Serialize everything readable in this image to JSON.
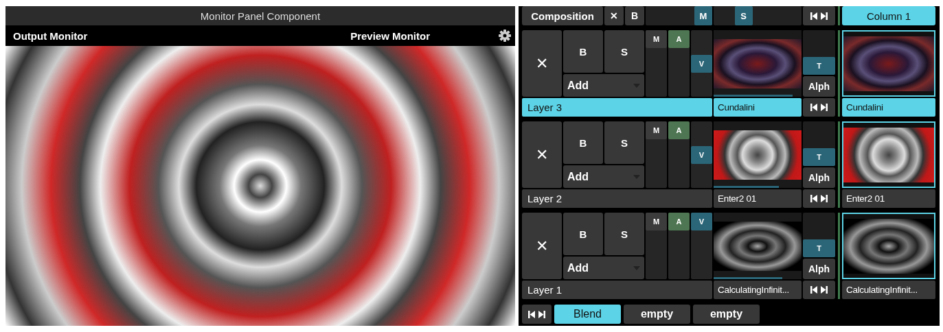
{
  "monitor": {
    "title": "Monitor Panel Component",
    "output_label": "Output Monitor",
    "preview_label": "Preview Monitor"
  },
  "composition": {
    "label": "Composition",
    "clear": "✕",
    "bypass": "B",
    "master": {
      "label": "M",
      "level": 1
    },
    "speed": {
      "label": "S",
      "level": 0.3
    }
  },
  "column": {
    "label": "Column 1",
    "selected": true
  },
  "layers": [
    {
      "name": "Layer 3",
      "selected": true,
      "clear": "✕",
      "bypass": "B",
      "solo": "S",
      "blend": "Add",
      "faders": [
        {
          "label": "M",
          "level": 1,
          "color": "#3c3c3c"
        },
        {
          "label": "A",
          "level": 1,
          "color": "#4e7652"
        },
        {
          "label": "V",
          "level": 0.5,
          "color": "#2b6678"
        }
      ],
      "transition": {
        "label": "T",
        "level": 0
      },
      "alpha": "Alph",
      "clip": {
        "name": "Cundalini",
        "selected": true,
        "level": 0.9
      },
      "column_clip": {
        "name": "Cundalini",
        "selected": true
      }
    },
    {
      "name": "Layer 2",
      "selected": false,
      "clear": "✕",
      "bypass": "B",
      "solo": "S",
      "blend": "Add",
      "faders": [
        {
          "label": "M",
          "level": 1,
          "color": "#3c3c3c"
        },
        {
          "label": "A",
          "level": 1,
          "color": "#4e7652"
        },
        {
          "label": "V",
          "level": 0.5,
          "color": "#2b6678"
        }
      ],
      "transition": {
        "label": "T",
        "level": 0
      },
      "alpha": "Alph",
      "clip": {
        "name": "Enter2 01",
        "selected": false,
        "level": 0.74
      },
      "column_clip": {
        "name": "Enter2 01",
        "selected": false
      }
    },
    {
      "name": "Layer 1",
      "selected": false,
      "clear": "✕",
      "bypass": "B",
      "solo": "S",
      "blend": "Add",
      "faders": [
        {
          "label": "M",
          "level": 1,
          "color": "#3c3c3c"
        },
        {
          "label": "A",
          "level": 1,
          "color": "#4e7652"
        },
        {
          "label": "V",
          "level": 1,
          "color": "#2b6678"
        }
      ],
      "transition": {
        "label": "T",
        "level": 0
      },
      "alpha": "Alph",
      "clip": {
        "name": "CalculatingInfinit...",
        "selected": false,
        "level": 0.78
      },
      "column_clip": {
        "name": "CalculatingInfinit...",
        "selected": false
      }
    }
  ],
  "footer": {
    "tabs": [
      {
        "label": "Blend",
        "selected": true
      },
      {
        "label": "empty",
        "selected": false
      },
      {
        "label": "empty",
        "selected": false
      }
    ]
  }
}
